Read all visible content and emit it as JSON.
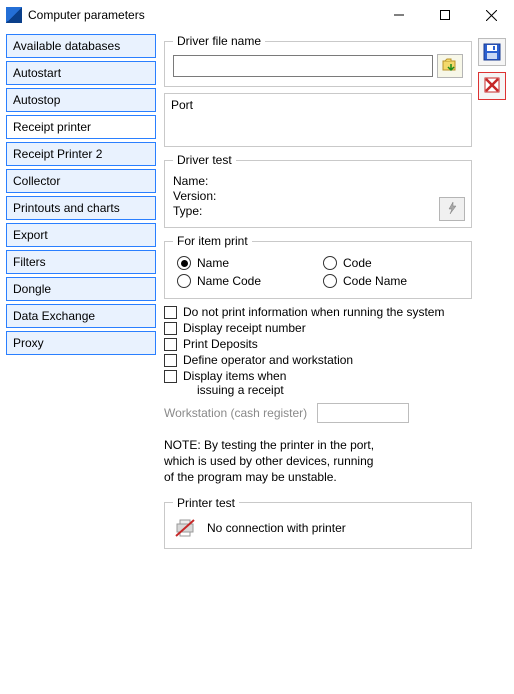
{
  "window": {
    "title": "Computer parameters"
  },
  "sidebar": {
    "items": [
      {
        "label": "Available databases"
      },
      {
        "label": "Autostart"
      },
      {
        "label": "Autostop"
      },
      {
        "label": "Receipt printer",
        "selected": true
      },
      {
        "label": "Receipt Printer 2"
      },
      {
        "label": "Collector"
      },
      {
        "label": "Printouts and charts"
      },
      {
        "label": "Export"
      },
      {
        "label": "Filters"
      },
      {
        "label": "Dongle"
      },
      {
        "label": "Data Exchange"
      },
      {
        "label": "Proxy"
      }
    ]
  },
  "driver_file": {
    "legend": "Driver file name",
    "value": ""
  },
  "port": {
    "label": "Port"
  },
  "driver_test": {
    "legend": "Driver test",
    "name_label": "Name:",
    "version_label": "Version:",
    "type_label": "Type:"
  },
  "item_print": {
    "legend": "For item print",
    "options": {
      "name": "Name",
      "code": "Code",
      "name_code": "Name Code",
      "code_name": "Code Name"
    },
    "selected": "name"
  },
  "checks": {
    "no_print_info": "Do not print information when running the system",
    "display_receipt_no": "Display receipt number",
    "print_deposits": "Print Deposits",
    "define_operator": "Define operator and workstation",
    "display_items_line1": "Display items when",
    "display_items_line2": "issuing a receipt"
  },
  "workstation": {
    "label": "Workstation (cash register)",
    "value": ""
  },
  "note": {
    "line1": "NOTE: By testing the printer in the port,",
    "line2": "which is used by other devices, running",
    "line3": "of the program may be unstable."
  },
  "printer_test": {
    "legend": "Printer test",
    "status": "No connection with printer"
  }
}
